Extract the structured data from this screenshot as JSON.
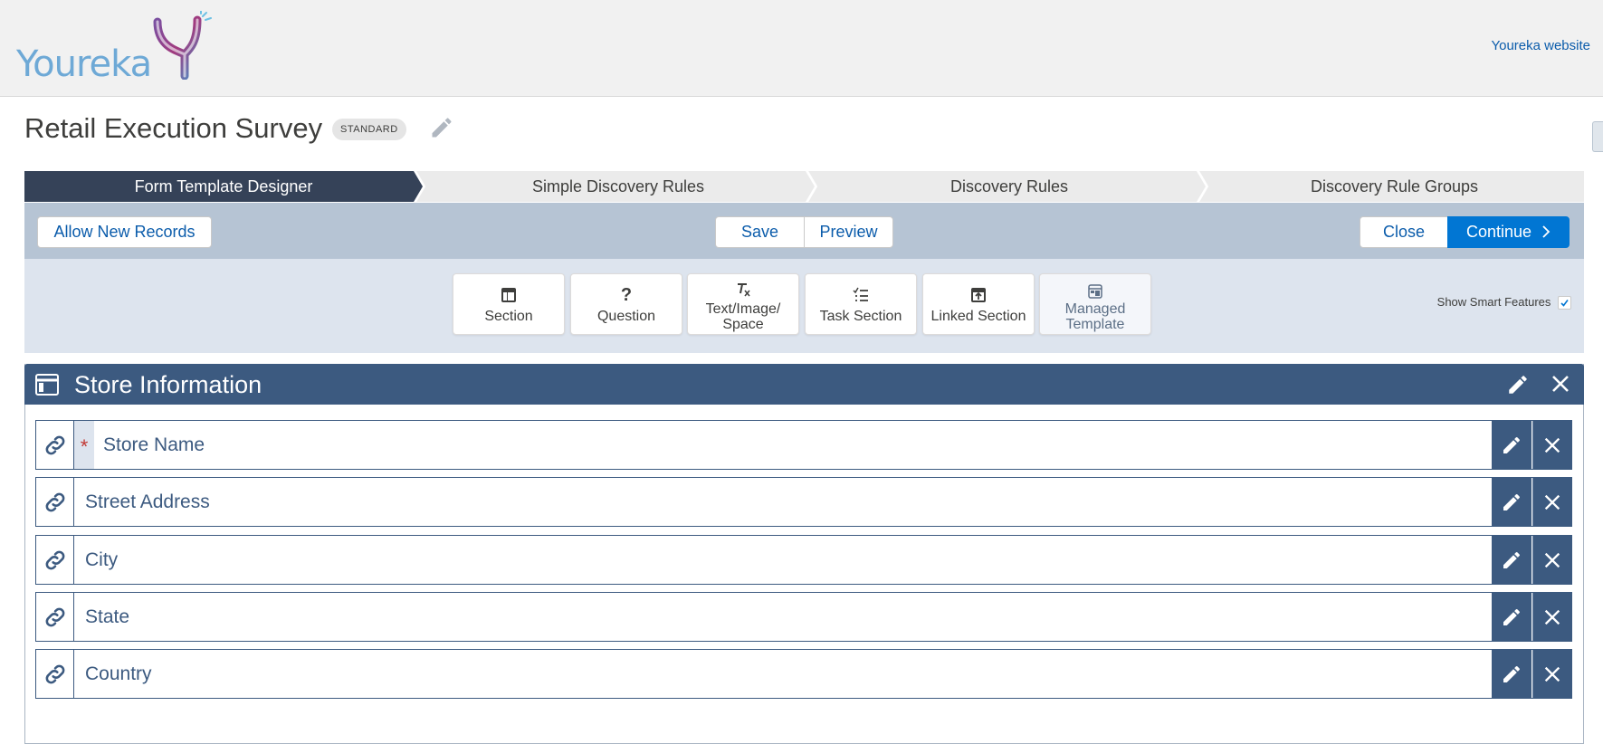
{
  "header": {
    "logo_text": "Youreka",
    "website_link": "Youreka website"
  },
  "page": {
    "title": "Retail Execution Survey",
    "badge": "STANDARD"
  },
  "path": {
    "steps": [
      {
        "label": "Form Template Designer",
        "active": true
      },
      {
        "label": "Simple Discovery Rules",
        "active": false
      },
      {
        "label": "Discovery Rules",
        "active": false
      },
      {
        "label": "Discovery Rule Groups",
        "active": false
      }
    ]
  },
  "toolbar": {
    "allow_new_records": "Allow New Records",
    "save": "Save",
    "preview": "Preview",
    "close": "Close",
    "continue": "Continue"
  },
  "palette": {
    "items": [
      {
        "label": "Section",
        "icon": "section-icon"
      },
      {
        "label": "Question",
        "icon": "question-icon"
      },
      {
        "label": "Text/Image/ Space",
        "icon": "text-format-icon"
      },
      {
        "label": "Task Section",
        "icon": "task-list-icon"
      },
      {
        "label": "Linked Section",
        "icon": "linked-section-icon"
      },
      {
        "label": "Managed Template",
        "icon": "template-icon"
      }
    ],
    "smart_features_label": "Show Smart Features",
    "smart_features_checked": true
  },
  "section": {
    "title": "Store Information",
    "fields": [
      {
        "label": "Store Name",
        "required": true
      },
      {
        "label": "Street Address",
        "required": false
      },
      {
        "label": "City",
        "required": false
      },
      {
        "label": "State",
        "required": false
      },
      {
        "label": "Country",
        "required": false
      }
    ]
  },
  "colors": {
    "nav_active": "#354258",
    "section_header": "#3c5a80",
    "toolbar_bg": "#b6c4d4",
    "palette_bg": "#dde4ee",
    "brand_blue": "#0176d3"
  }
}
